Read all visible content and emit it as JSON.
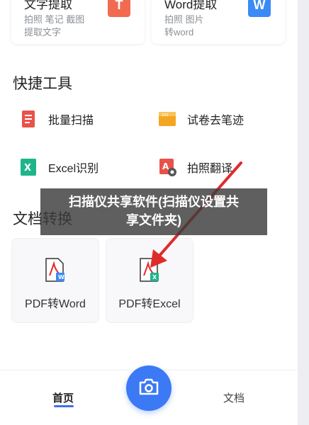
{
  "top_cards": [
    {
      "title": "文字提取",
      "sub1": "拍照 笔记 截图",
      "sub2": "提取文字",
      "icon": "T",
      "icon_color": "#f26a4f"
    },
    {
      "title": "Word提取",
      "sub1": "拍照 图片",
      "sub2": "转word",
      "icon": "W",
      "icon_color": "#3b8af5"
    }
  ],
  "quick_tools": {
    "title": "快捷工具",
    "items": [
      {
        "label": "批量扫描",
        "icon": "batch-scan-icon",
        "color": "#e8524a"
      },
      {
        "label": "试卷去笔迹",
        "icon": "exam-erase-icon",
        "color": "#f4a623"
      },
      {
        "label": "Excel识别",
        "icon": "excel-recognize-icon",
        "color": "#1fb58a"
      },
      {
        "label": "拍照翻译",
        "icon": "photo-translate-icon",
        "color": "#e8524a"
      }
    ]
  },
  "doc_convert": {
    "title": "文档转换",
    "items": [
      {
        "label": "PDF转Word",
        "icon": "pdf-to-word-icon",
        "badge": "W",
        "badge_color": "#3b8af5"
      },
      {
        "label": "PDF转Excel",
        "icon": "pdf-to-excel-icon",
        "badge": "X",
        "badge_color": "#1fb58a"
      }
    ]
  },
  "nav": {
    "home": "首页",
    "docs": "文档",
    "camera": "camera-icon"
  },
  "banner": {
    "line1": "扫描仪共享软件(扫描仪设置共",
    "line2": "享文件夹)"
  },
  "colors": {
    "accent": "#3b79f5",
    "arrow": "#e02b2b"
  }
}
